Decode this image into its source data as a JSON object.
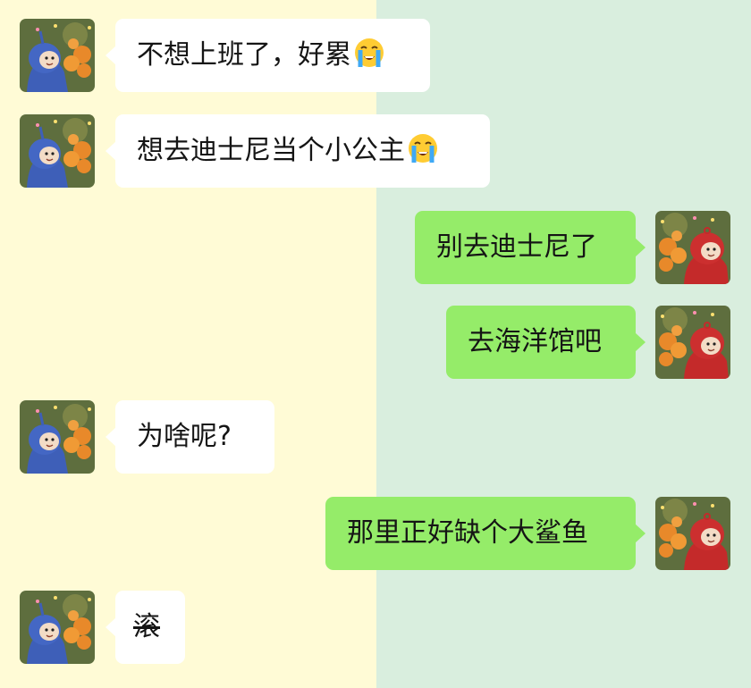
{
  "chat": {
    "messages": [
      {
        "sender": "blue-teletubby",
        "direction": "incoming",
        "text": "不想上班了，好累",
        "emoji": "loudly-crying-face"
      },
      {
        "sender": "blue-teletubby",
        "direction": "incoming",
        "text": "想去迪士尼当个小公主",
        "emoji": "loudly-crying-face"
      },
      {
        "sender": "red-teletubby",
        "direction": "outgoing",
        "text": "别去迪士尼了"
      },
      {
        "sender": "red-teletubby",
        "direction": "outgoing",
        "text": "去海洋馆吧"
      },
      {
        "sender": "blue-teletubby",
        "direction": "incoming",
        "text": "为啥呢?"
      },
      {
        "sender": "red-teletubby",
        "direction": "outgoing",
        "text": "那里正好缺个大鲨鱼"
      },
      {
        "sender": "blue-teletubby",
        "direction": "incoming",
        "text": "滚",
        "strikethrough": true
      }
    ]
  },
  "colors": {
    "left_background": "#FFFBD6",
    "right_background": "#D9EEDE",
    "incoming_bubble": "#FFFFFF",
    "outgoing_bubble": "#95EC69",
    "text": "#151515"
  }
}
